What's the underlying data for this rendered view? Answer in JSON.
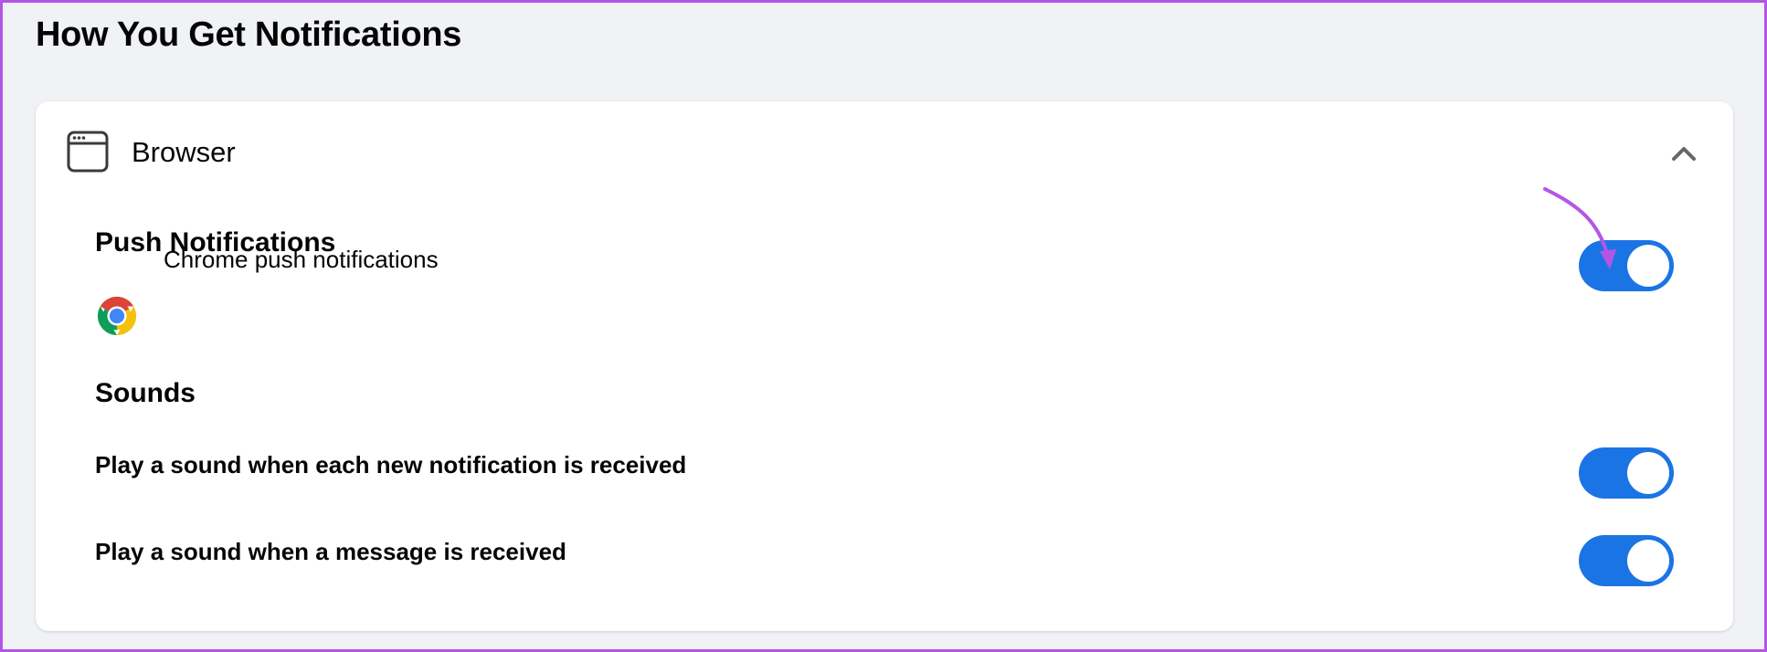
{
  "page": {
    "title": "How You Get Notifications"
  },
  "browser_section": {
    "title": "Browser",
    "icon": "browser-window-icon",
    "expanded": true,
    "push": {
      "heading": "Push Notifications",
      "items": [
        {
          "label": "Chrome push notifications",
          "icon": "chrome-icon",
          "enabled": true
        }
      ]
    },
    "sounds": {
      "heading": "Sounds",
      "items": [
        {
          "label": "Play a sound when each new notification is received",
          "enabled": true
        },
        {
          "label": "Play a sound when a message is received",
          "enabled": true
        }
      ]
    }
  },
  "colors": {
    "toggle_on": "#1b74e4",
    "annotation_arrow": "#b455e6",
    "background": "#f0f2f5"
  }
}
